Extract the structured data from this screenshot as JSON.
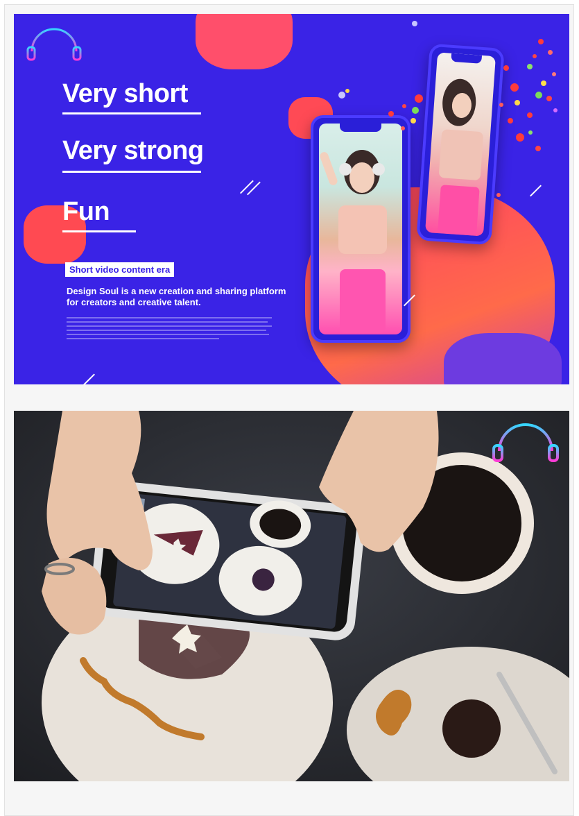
{
  "panel1": {
    "headlines": [
      "Very short",
      "Very strong",
      "Fun"
    ],
    "tag": "Short video content era",
    "description": "Design Soul is a new creation and sharing platform for creators and creative talent.",
    "logo_icon": "headphones-equalizer-icon",
    "colors": {
      "background": "#3a23e6",
      "accent": "#ff4f5e",
      "text": "#ffffff"
    }
  },
  "panel2": {
    "logo_icon": "headphones-equalizer-icon"
  }
}
